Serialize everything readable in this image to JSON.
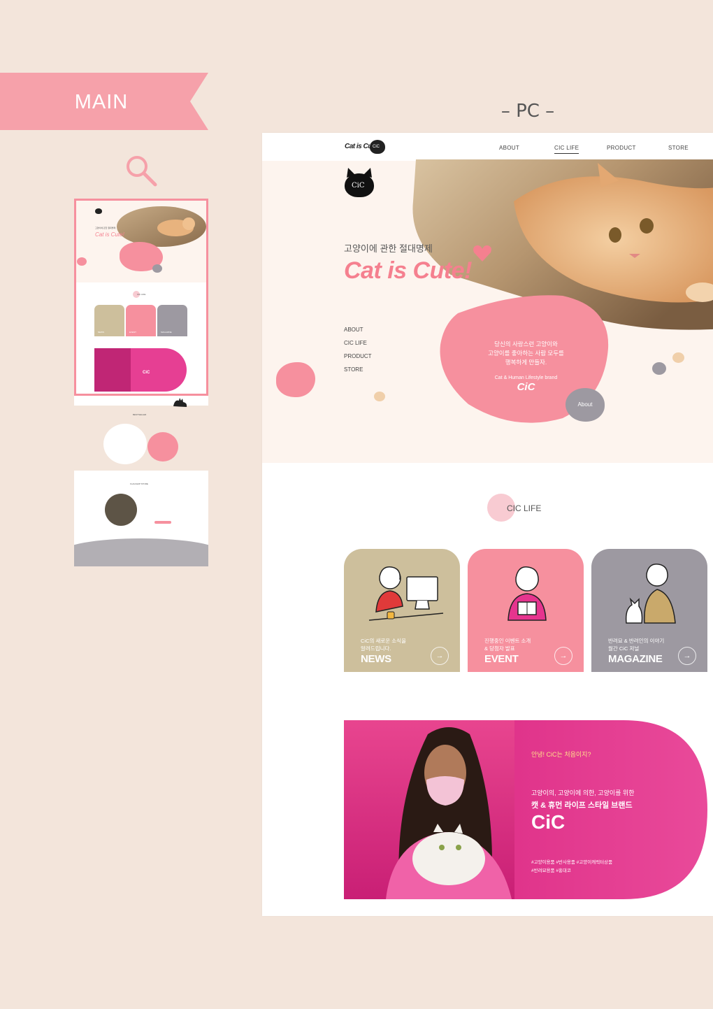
{
  "banner": {
    "label": "MAIN"
  },
  "pc_label": "– PC –",
  "nav": {
    "logo_text": "Cat is Cute",
    "logo_badge": "CiC",
    "items": [
      "ABOUT",
      "CIC LIFE",
      "PRODUCT",
      "STORE"
    ]
  },
  "hero": {
    "badge": "CiC",
    "subtitle": "고양이에 관한 절대명제",
    "title": "Cat is Cute!",
    "side_links": [
      "ABOUT",
      "CIC LIFE",
      "PRODUCT",
      "STORE"
    ],
    "blob_line1": "당신의 사랑스런 고양이와",
    "blob_line2": "고양이를 좋아하는 사람 모두를",
    "blob_line3": "행복하게 만들자.",
    "brand_tagline": "Cat & Human Lifestyle brand",
    "brand_name": "CiC",
    "about_button": "About"
  },
  "cic_life": {
    "heading": "CIC LIFE",
    "cards": [
      {
        "sub1": "CiC의 새로운 소식을",
        "sub2": "알려드립니다.",
        "title": "NEWS",
        "color": "#cdbf9c"
      },
      {
        "sub1": "진행중인 이벤트 소개",
        "sub2": "& 당첨자 발표",
        "title": "EVENT",
        "color": "#f6909e"
      },
      {
        "sub1": "반려묘 & 반려인의 이야기",
        "sub2": "월간 CiC 저널",
        "title": "MAGAZINE",
        "color": "#9d99a1"
      }
    ],
    "arrow": "→"
  },
  "promo": {
    "greeting": "안녕! CiC는 처음이지?",
    "line1": "고양이의, 고양이에 의한, 고양이를 위한",
    "line2": "캣 & 휴먼 라이프 스타일 브랜드",
    "brand": "CiC",
    "tags1": "#고양이용품 #반사용품 #고양이캐릭터상품",
    "tags2": "#반려묘용품 #홍대코"
  },
  "thumbnail": {
    "title": "Cat is Cute!",
    "subtitle": "고양이에 관한 절대명제",
    "cic_life": "CIC LIFE",
    "bestseller": "BESTSELLER",
    "flagship": "FLAGSHIP STORE",
    "cards": [
      "NEWS",
      "EVENT",
      "MAGAZINE"
    ],
    "brand": "CiC"
  },
  "colors": {
    "background": "#f3e5db",
    "pink": "#f6909e",
    "hot_pink": "#e63f93",
    "tan": "#cdbf9c",
    "gray": "#9d99a1"
  }
}
